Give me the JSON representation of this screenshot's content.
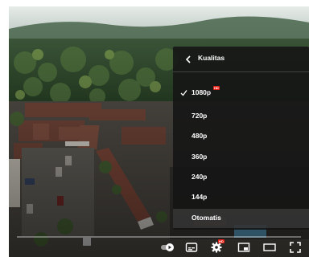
{
  "settings_menu": {
    "back_icon": "chevron-left-icon",
    "title": "Kualitas",
    "selected_quality": "1080p",
    "options": [
      {
        "label": "1080p",
        "badge": "HD",
        "selected": true
      },
      {
        "label": "720p",
        "badge": "",
        "selected": false
      },
      {
        "label": "480p",
        "badge": "",
        "selected": false
      },
      {
        "label": "360p",
        "badge": "",
        "selected": false
      },
      {
        "label": "240p",
        "badge": "",
        "selected": false
      },
      {
        "label": "144p",
        "badge": "",
        "selected": false
      },
      {
        "label": "Otomatis",
        "badge": "",
        "selected": false
      }
    ]
  },
  "controls": {
    "icons": [
      "autoplay-toggle-icon",
      "subtitles-icon",
      "settings-gear-icon",
      "miniplayer-icon",
      "theater-mode-icon",
      "fullscreen-icon"
    ],
    "settings_badge": "HD"
  },
  "colors": {
    "accent_red": "#e62117",
    "menu_bg": "#141414",
    "text": "#ffffff"
  }
}
